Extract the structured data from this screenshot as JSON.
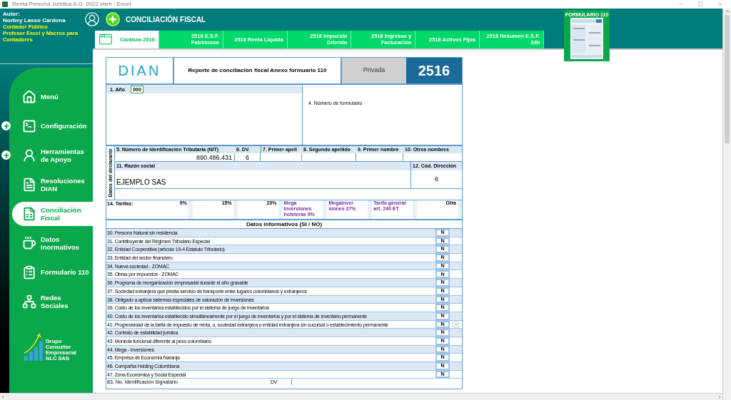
{
  "title_bar": {
    "title": "Renta Persona Juridica A.G. 2022.xlsm - Excel"
  },
  "author": {
    "label": "Autor:",
    "name": "Norbey Lasso Cardona",
    "roles": [
      "Contador Público",
      "Profesor Excel y Macros para Contadores"
    ]
  },
  "header": {
    "title": "CONCILIACIÓN FISCAL"
  },
  "tabs": [
    {
      "label": "Carátula 2516",
      "selected": true
    },
    {
      "label": "2516 E.S.F. Patrimonio",
      "selected": false
    },
    {
      "label": "2516 Renta Liquida",
      "selected": false
    },
    {
      "label": "2516 Impuesto Diferido",
      "selected": false
    },
    {
      "label": "2516 Ingresos y Facturación",
      "selected": false
    },
    {
      "label": "2516 Activos Fijos",
      "selected": false
    },
    {
      "label": "2516 Resumen E.S.F. ERI",
      "selected": false
    }
  ],
  "thumbnail": {
    "title": "FORMULARIO 110"
  },
  "sidebar": {
    "items": [
      {
        "label": "Menú",
        "kind": "home",
        "expandable": false,
        "selected": false
      },
      {
        "label": "Configuración",
        "kind": "terminal",
        "expandable": true,
        "selected": false
      },
      {
        "label": "Herramientas de Apoyo",
        "kind": "person",
        "expandable": true,
        "selected": false
      },
      {
        "label": "Resoluciones DIAN",
        "kind": "document",
        "expandable": false,
        "selected": false
      },
      {
        "label": "Conciliación Fiscal",
        "kind": "spreadsheet",
        "expandable": false,
        "selected": true
      },
      {
        "label": "Datos Inormativos",
        "kind": "coffee",
        "expandable": false,
        "selected": false
      },
      {
        "label": "Formulario 110",
        "kind": "form",
        "expandable": false,
        "selected": false
      },
      {
        "label": "Redes Sociales",
        "kind": "network",
        "expandable": false,
        "selected": false
      }
    ],
    "brand": [
      "Grupo",
      "Consultor",
      "Empresarial",
      "NLC SAS"
    ]
  },
  "form": {
    "logo": "DIAN",
    "title": "Reporte de conciliación fiscal Anexo formuario 110",
    "privacy": "Privada",
    "number": "2516",
    "year_label": "1. Año",
    "year": "000",
    "form_number_label": "4. Número de formulario",
    "side_label": "Datos del declarante",
    "nit_label": "5. Número de Identificación Tributaria (NIT)",
    "dv_label": "6. DV.",
    "surname1_label": "7. Primer apell",
    "surname2_label": "8. Segundo apellido",
    "name1_label": "9. Primer nombre",
    "name2_label": "10. Otros nombres",
    "nit": "890.486.431",
    "dv": "6",
    "company_label": "11. Razón social",
    "address_code_label": "12. Cód. Dirección",
    "company": "EJEMPLO SAS",
    "address_code": "6",
    "rates": {
      "label": "14. Tarifas:",
      "items": [
        "9%",
        "15%",
        "20%",
        "Mega inversiones hoteleras 9%",
        "Megainver siones 27%",
        "Tarifa general art. 240 ET",
        "Otra"
      ]
    },
    "section_title": "Datos informativos (SI / NO)",
    "rows": [
      {
        "label": "30. Persona Natural sin residencia",
        "value": "N",
        "dropdown": false
      },
      {
        "label": "31. Contribuyente del Régimen Tributario Especial",
        "value": "N",
        "dropdown": false
      },
      {
        "label": "32. Entidad Cooperativa (artículo 19-4 Estatuto Tributario)",
        "value": "N",
        "dropdown": false
      },
      {
        "label": "33. Entidad del sector financiero",
        "value": "N",
        "dropdown": false
      },
      {
        "label": "34. Nueva sociedad - ZOMAC",
        "value": "N",
        "dropdown": false
      },
      {
        "label": "35. Obras por impuestos - ZOMAC",
        "value": "N",
        "dropdown": false
      },
      {
        "label": "36. Programa de reorganización empresarial durante el año gravable",
        "value": "N",
        "dropdown": false
      },
      {
        "label": "37. Sociedad extranjera que presta servicio de transporte entre lugares colombianos y extranjeros",
        "value": "N",
        "dropdown": false
      },
      {
        "label": "38. Obligado a aplicar sistemas especiales de valoración de inversiones",
        "value": "N",
        "dropdown": false
      },
      {
        "label": "39. Costo de los inventarios establecidos por el sistema de juego de inventarios",
        "value": "N",
        "dropdown": false
      },
      {
        "label": "40. Costo de los inventarios establecido simultáneamente por el juego de inventarios y por el sistema de inventario permanente",
        "value": "N",
        "dropdown": false
      },
      {
        "label": "41. Progresividad de la tarifa de impuesto de renta, o, sociedad extranjera o entidad extranjera sin sucursal o establecimiento permanente",
        "value": "N",
        "dropdown": true
      },
      {
        "label": "42. Contrato de estabilidad jurídica",
        "value": "N",
        "dropdown": false
      },
      {
        "label": "43. Moneda funcional diferente al peso colombiano",
        "value": "N",
        "dropdown": false
      },
      {
        "label": "44. Mega - Inversiones",
        "value": "N",
        "dropdown": false
      },
      {
        "label": "45. Empresa de Economía Naranja",
        "value": "N",
        "dropdown": false
      },
      {
        "label": "46. Compañía Holding Colombiana",
        "value": "N",
        "dropdown": false
      },
      {
        "label": "47. Zona Económica y Social Especial",
        "value": "N",
        "dropdown": false
      }
    ],
    "signatory_label": "83. No. Identificación Signatario",
    "signatory_dv_label": "DV"
  }
}
